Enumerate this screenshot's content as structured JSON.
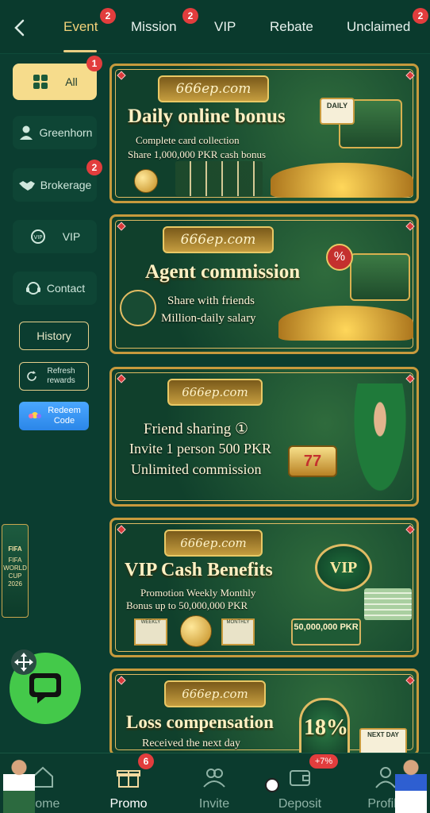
{
  "tabs": [
    {
      "label": "Event",
      "badge": "2",
      "active": true
    },
    {
      "label": "Mission",
      "badge": "2"
    },
    {
      "label": "VIP"
    },
    {
      "label": "Rebate"
    },
    {
      "label": "Unclaimed",
      "badge": "2"
    }
  ],
  "sidebar": {
    "items": [
      {
        "label": "All",
        "badge": "1",
        "active": true
      },
      {
        "label": "Greenhorn"
      },
      {
        "label": "Brokerage",
        "badge": "2"
      },
      {
        "label": "VIP"
      },
      {
        "label": "Contact"
      }
    ],
    "history_label": "History",
    "refresh_label": "Refresh rewards",
    "redeem_label": "Redeem Code"
  },
  "banners": [
    {
      "brand": "666ep.com",
      "title": "Daily online bonus",
      "lines": [
        "Complete card collection",
        "Share 1,000,000 PKR cash bonus"
      ],
      "tag": "DAILY"
    },
    {
      "brand": "666ep.com",
      "title": "Agent commission",
      "lines": [
        "Share with friends",
        "Million-daily salary"
      ]
    },
    {
      "brand": "666ep.com",
      "title": "",
      "lines": [
        "Friend sharing ①",
        "Invite 1 person 500 PKR",
        "Unlimited commission"
      ]
    },
    {
      "brand": "666ep.com",
      "title": "VIP Cash Benefits",
      "lines": [
        "Promotion Weekly Monthly",
        "Bonus up to 50,000,000 PKR"
      ],
      "badge_text": "VIP",
      "cash_text": "50,000,000 PKR",
      "weekly": "WEEKLY",
      "monthly": "MONTHLY"
    },
    {
      "brand": "666ep.com",
      "title": "Loss compensation",
      "lines": [
        "Received the next day"
      ],
      "percent": "18%",
      "tag": "NEXT DAY"
    }
  ],
  "left_decor": {
    "lines": [
      "FIFA",
      "FIFA WORLD CUP 2026"
    ]
  },
  "bottom_nav": [
    {
      "label": "Home"
    },
    {
      "label": "Promo",
      "badge": "6",
      "active": true
    },
    {
      "label": "Invite"
    },
    {
      "label": "Deposit",
      "badge": "+7%"
    },
    {
      "label": "Profile"
    }
  ],
  "colors": {
    "background": "#0b3d30",
    "accent_gold": "#f3d27a",
    "badge_red": "#e23d3d",
    "chat_green": "#44c94a"
  }
}
